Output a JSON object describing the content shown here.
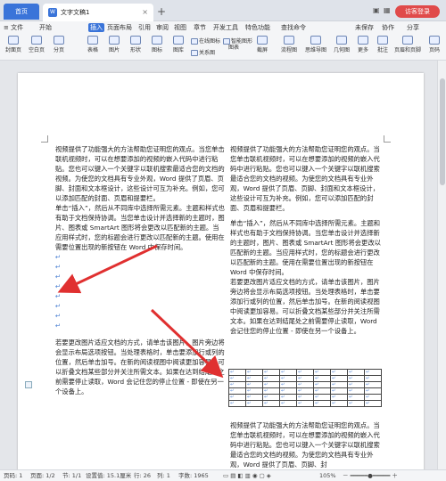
{
  "titlebar": {
    "home_tab": "首页",
    "doc_tab": "文字文稿1",
    "doc_tab_icon": "W",
    "close_glyph": "×",
    "new_tab_glyph": "+",
    "login": "访客登录"
  },
  "menu": {
    "file": "≡ 文件",
    "items": [
      "开始",
      "插入",
      "页面布局",
      "引用",
      "审阅",
      "视图",
      "章节",
      "开发工具",
      "特色功能"
    ],
    "active": "插入",
    "search": "查找命令",
    "right_items": [
      "未保存",
      "协作",
      "分享"
    ]
  },
  "toolbar": {
    "groups": [
      {
        "label": "封面页"
      },
      {
        "label": "空白页"
      },
      {
        "label": "分页"
      },
      {
        "label": "表格"
      },
      {
        "label": "图片"
      },
      {
        "label": "形状"
      },
      {
        "label": "图标"
      },
      {
        "label": "图库"
      },
      {
        "label": "关系图"
      },
      {
        "label": "图表"
      },
      {
        "label": "截屏"
      },
      {
        "label": "流程图"
      },
      {
        "label": "思维导图"
      },
      {
        "label": "几何图"
      },
      {
        "label": "更多"
      },
      {
        "label": "批注"
      },
      {
        "label": "页眉和页脚"
      },
      {
        "label": "页码"
      }
    ],
    "small": [
      "在线图标",
      "智能图形"
    ]
  },
  "document": {
    "left_column": [
      "视频提供了功能强大的方法帮助您证明您的观点。当您单击联机视频时，可以在想要添加的视频的嵌入代码中进行粘贴。您也可以键入一个关键字以联机搜索最适合您的文档的视频。为使您的文档具有专业外观，Word 提供了页眉、页脚、封面和文本框设计，这些设计可互为补充。例如，您可以添加匹配的封面、页眉和提要栏。",
      "单击“插入”，然后从不同库中选择所需元素。主题和样式也有助于文档保持协调。当您单击设计并选择新的主题时，图片、图表或 SmartArt 图形将会更改以匹配新的主题。当应用样式时，您的标题会进行更改以匹配新的主题。使用在需要位置出现的新按钮在 Word 中保存时间。",
      "",
      "",
      "",
      "",
      "",
      "",
      "",
      "",
      "",
      "若要更改图片适应文档的方式，请单击该图片，图片旁边将会显示布局选项按钮。当处理表格时，单击要添加行或列的位置，然后单击加号。在新的阅读视图中阅读更加容易。可以折叠文档某些部分并关注所需文本。如果在达到结尾处之前需要停止读取，Word 会记住您的停止位置 - 即使在另一个设备上。"
    ],
    "right_column": [
      "视频提供了功能强大的方法帮助您证明您的观点。当您单击联机视频时，可以在想要添加的视频的嵌入代码中进行粘贴。您也可以键入一个关键字以联机搜索最适合您的文档的视频。为使您的文档具有专业外观，Word 提供了页眉、页脚、封面和文本框设计，这些设计可互为补充。例如，您可以添加匹配的封面、页眉和提要栏。",
      "单击“插入”，然后从不同库中选择所需元素。主题和样式也有助于文档保持协调。当您单击设计并选择新的主题时，图片、图表或 SmartArt 图形将会更改以匹配新的主题。当应用样式时，您的标题会进行更改以匹配新的主题。使用在需要位置出现的新按钮在 Word 中保存时间。",
      "若要更改图片适应文档的方式，请单击该图片，图片旁边将会显示布局选项按钮。当处理表格时，单击要添加行或列的位置，然后单击加号。在新的阅读视图中阅读更加容易。可以折叠文档某些部分并关注所需文本。如果在达到结尾处之前需要停止读取，Word 会记住您的停止位置 - 即使在另一个设备上。",
      "视频提供了功能强大的方法帮助您证明您的观点。当您单击联机视频时，可以在想要添加的视频的嵌入代码中进行粘贴。您也可以键入一个关键字以联机搜索最适合您的文档的视频。为使您的文档具有专业外观，Word 提供了页眉、页脚、封"
    ],
    "para_mark": "↵",
    "table": {
      "rows": 6,
      "cols": 9
    }
  },
  "annotations": {
    "arrow_color": "#e03030"
  },
  "status": {
    "page": "页码: 1",
    "pages": "页面: 1/2",
    "section": "节: 1/1",
    "setting": "设置值: 15.1厘米",
    "row": "行: 26",
    "column": "列: 1",
    "words": "字数: 1965",
    "zoom": "105%"
  },
  "colors": {
    "accent": "#3a74d9",
    "login": "#e04a4a",
    "arrow": "#e03030"
  }
}
